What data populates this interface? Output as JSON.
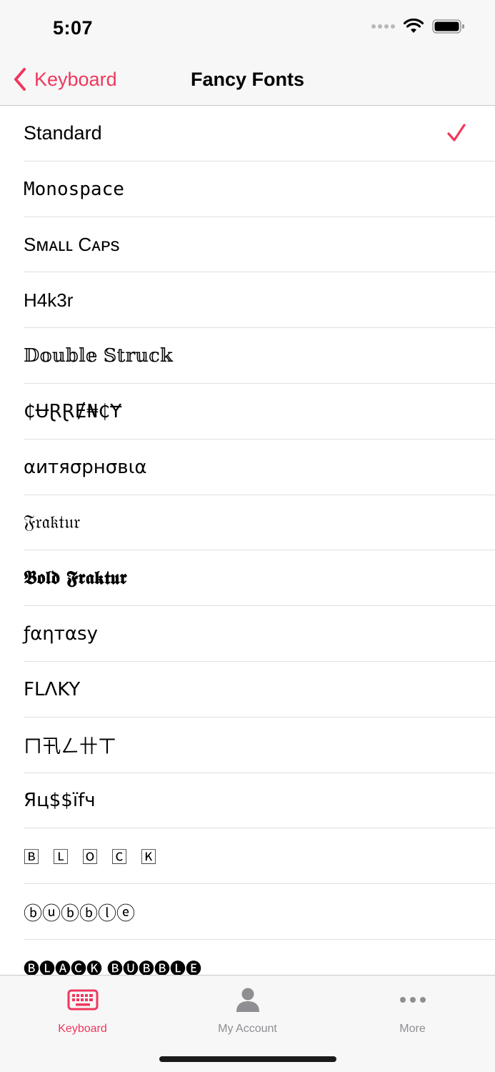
{
  "status_bar": {
    "time": "5:07"
  },
  "nav": {
    "back_label": "Keyboard",
    "title": "Fancy Fonts"
  },
  "accent_color": "#f0375c",
  "fonts": {
    "items": [
      {
        "label": "Standard",
        "selected": true
      },
      {
        "label": "𝙼𝚘𝚗𝚘𝚜𝚙𝚊𝚌𝚎",
        "selected": false
      },
      {
        "label": "Sᴍᴀʟʟ Cᴀᴘs",
        "selected": false
      },
      {
        "label": "H4k3r",
        "selected": false
      },
      {
        "label": "𝔻𝕠𝕦𝕓𝕝𝕖 𝕊𝕥𝕣𝕦𝕔𝕜",
        "selected": false
      },
      {
        "label": "₵ɄⱤⱤɆ₦₵Ɏ",
        "selected": false
      },
      {
        "label": "αитяσрнσвια",
        "selected": false
      },
      {
        "label": "𝔉𝔯𝔞𝔨𝔱𝔲𝔯",
        "selected": false
      },
      {
        "label": "𝕭𝖔𝖑𝖉 𝕱𝖗𝖆𝖐𝖙𝖚𝖗",
        "selected": false
      },
      {
        "label": "ƒαηтαѕу",
        "selected": false
      },
      {
        "label": "FLΛKY",
        "selected": false
      },
      {
        "label": "ㄇ卂ㄥ卄ㄒ",
        "selected": false
      },
      {
        "label": "Яц$$їfч",
        "selected": false
      },
      {
        "label": "🄱 🄻 🄾 🄲 🄺",
        "selected": false
      },
      {
        "label": "ⓑⓤⓑⓑⓛⓔ",
        "selected": false
      },
      {
        "label": "🅑🅛🅐🅒🅚 🅑🅤🅑🅑🅛🅔",
        "selected": false
      }
    ]
  },
  "tabs": [
    {
      "label": "Keyboard",
      "icon": "keyboard-icon",
      "active": true
    },
    {
      "label": "My Account",
      "icon": "person-icon",
      "active": false
    },
    {
      "label": "More",
      "icon": "more-icon",
      "active": false
    }
  ]
}
